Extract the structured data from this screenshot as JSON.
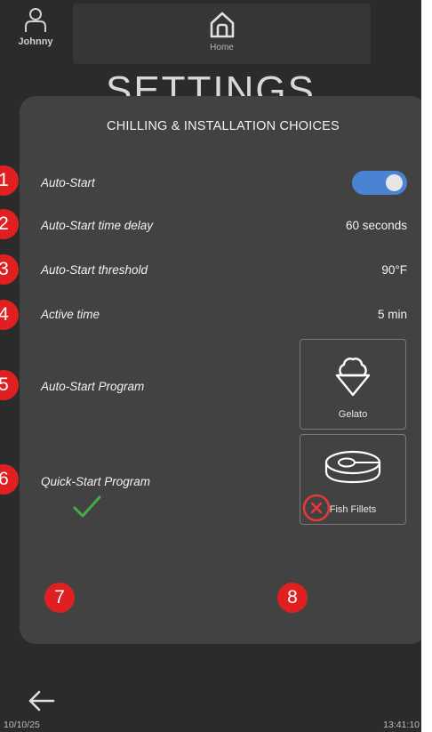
{
  "header": {
    "user_name": "Johnny",
    "home_label": "Home",
    "page_title": "SETTINGS"
  },
  "dialog": {
    "title": "CHILLING & INSTALLATION CHOICES",
    "rows": [
      {
        "label": "Auto-Start",
        "toggle_on": true
      },
      {
        "label": "Auto-Start time delay",
        "value": "60 seconds"
      },
      {
        "label": "Auto-Start threshold",
        "value": "90°F"
      },
      {
        "label": "Active time",
        "value": "5 min"
      },
      {
        "label": "Auto-Start Program",
        "program": "Gelato",
        "icon": "ice-cream-icon"
      },
      {
        "label": "Quick-Start Program",
        "program": "Fish Fillets",
        "icon": "fish-fillet-icon"
      }
    ]
  },
  "badges": [
    "1",
    "2",
    "3",
    "4",
    "5",
    "6",
    "7",
    "8"
  ],
  "footer": {
    "date": "10/10/25",
    "time": "13:41:10"
  },
  "colors": {
    "background": "#2b2b2b",
    "dialog": "#424242",
    "toggle_on": "#4a83d4",
    "confirm": "#3fae4a",
    "cancel": "#e53935",
    "badge": "#e02020"
  }
}
